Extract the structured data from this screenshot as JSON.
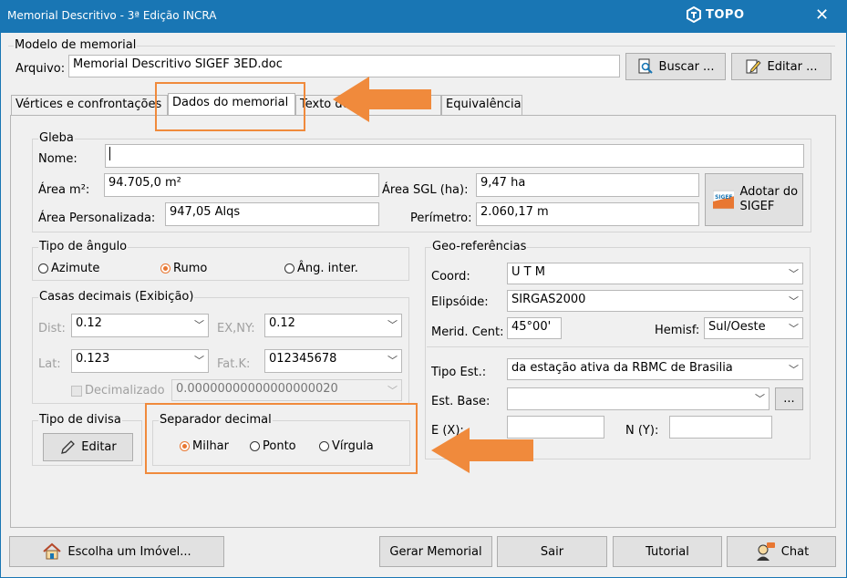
{
  "window": {
    "title": "Memorial Descritivo - 3ª Edição INCRA",
    "brand": "TOPO",
    "close": "✕"
  },
  "modelo": {
    "legend": "Modelo de memorial",
    "arquivo_label": "Arquivo:",
    "arquivo_value": "Memorial Descritivo SIGEF 3ED.doc",
    "buscar_label": "Buscar ...",
    "editar_label": "Editar ..."
  },
  "tabs": [
    {
      "label": "Vértices e confrontações"
    },
    {
      "label": "Dados do memorial"
    },
    {
      "label": "Texto do memorial"
    },
    {
      "label": "Equivalência"
    }
  ],
  "gleba": {
    "legend": "Gleba",
    "nome_label": "Nome:",
    "nome_value": "",
    "area_m2_label": "Área m²:",
    "area_m2_value": "94.705,0 m²",
    "area_sgl_label": "Área SGL (ha):",
    "area_sgl_value": "9,47 ha",
    "area_pers_label": "Área Personalizada:",
    "area_pers_value": "947,05 Alqs",
    "perimetro_label": "Perímetro:",
    "perimetro_value": "2.060,17 m",
    "adotar_label": "Adotar do SIGEF",
    "sigef_logo": "SIGEF"
  },
  "tipo_angulo": {
    "legend": "Tipo de ângulo",
    "options": [
      "Azimute",
      "Rumo",
      "Âng. inter."
    ],
    "selected": "Rumo"
  },
  "casas_decimais": {
    "legend": "Casas decimais (Exibição)",
    "dist_label": "Dist:",
    "dist_value": "0.12",
    "exny_label": "EX,NY:",
    "exny_value": "0.12",
    "lat_label": "Lat:",
    "lat_value": "0.123",
    "fatk_label": "Fat.K:",
    "fatk_value": "012345678",
    "decimalizado_label": "Decimalizado",
    "decimalizado_value": "0.00000000000000000020"
  },
  "tipo_divisa": {
    "legend": "Tipo de divisa",
    "editar_label": "Editar"
  },
  "separador": {
    "legend": "Separador decimal",
    "options": [
      "Milhar",
      "Ponto",
      "Vírgula"
    ],
    "selected": "Milhar"
  },
  "geo": {
    "legend": "Geo-referências",
    "coord_label": "Coord:",
    "coord_value": "U T M",
    "elipsoide_label": "Elipsóide:",
    "elipsoide_value": "SIRGAS2000",
    "merid_label": "Merid. Cent:",
    "merid_value": "45°00'",
    "hemisf_label": "Hemisf:",
    "hemisf_value": "Sul/Oeste",
    "tipo_est_label": "Tipo Est.:",
    "tipo_est_value": "da estação ativa da RBMC de Brasilia",
    "est_base_label": "Est. Base:",
    "est_base_value": "",
    "est_base_btn": "...",
    "ex_label": "E (X):",
    "ex_value": "",
    "ny_label": "N (Y):",
    "ny_value": ""
  },
  "footer": {
    "escolha_label": "Escolha um Imóvel...",
    "gerar_label": "Gerar Memorial",
    "sair_label": "Sair",
    "tutorial_label": "Tutorial",
    "chat_label": "Chat"
  },
  "colors": {
    "titlebar": "#1976b4",
    "highlight": "#f08a3c",
    "radio_selected": "#e87732"
  }
}
